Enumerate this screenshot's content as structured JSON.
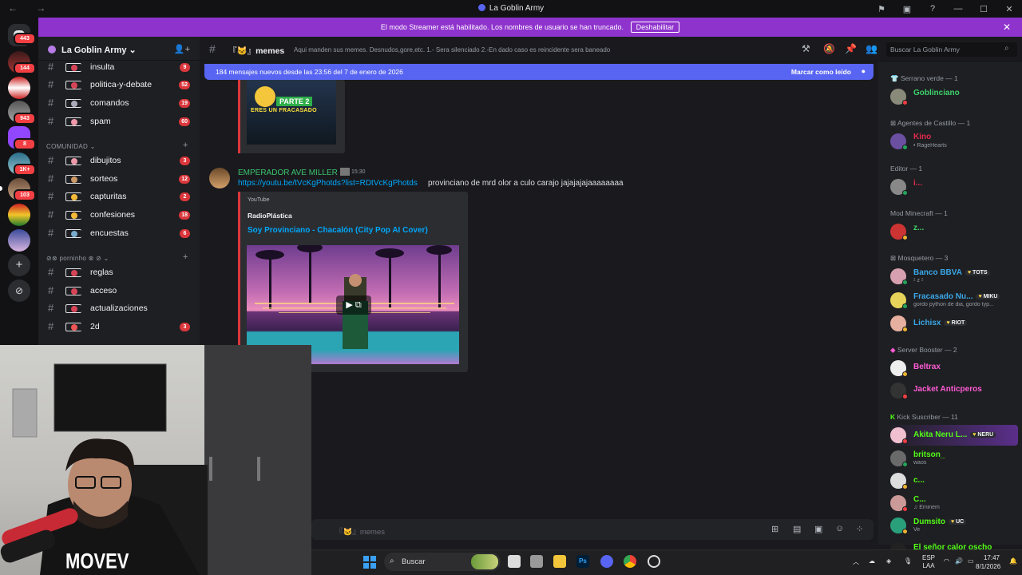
{
  "window": {
    "title": "La Goblin Army",
    "nav": "← →"
  },
  "banner": {
    "text": "El modo Streamer está habilitado. Los nombres de usuario se han truncado.",
    "button": "Deshabilitar"
  },
  "rail_badges": [
    "443",
    "144",
    "943",
    "8",
    "1K+",
    "103"
  ],
  "guild": {
    "name": "La Goblin Army"
  },
  "channels_top": [
    {
      "name": "insulta",
      "count": "9"
    },
    {
      "name": "politica-y-debate",
      "count": "52"
    },
    {
      "name": "comandos",
      "count": "19"
    },
    {
      "name": "spam",
      "count": "60"
    }
  ],
  "category_comunidad": "COMUNIDAD",
  "channels_comunidad": [
    {
      "name": "dibujitos",
      "count": "3"
    },
    {
      "name": "sorteos",
      "count": "12"
    },
    {
      "name": "capturitas",
      "count": "2"
    },
    {
      "name": "confesiones",
      "count": "18"
    },
    {
      "name": "encuestas",
      "count": "6"
    }
  ],
  "category_porn": "porninho",
  "channels_porn": [
    {
      "name": "reglas",
      "count": ""
    },
    {
      "name": "acceso",
      "count": ""
    },
    {
      "name": "actualizaciones",
      "count": ""
    },
    {
      "name": "2d",
      "count": "3"
    }
  ],
  "channel_header": {
    "name": "memes",
    "topic": "Aqui manden sus memes. Desnudos,gore,etc. 1.- Sera silenciado 2.-En dado caso es reincidente sera baneado"
  },
  "search": {
    "placeholder": "Buscar La Goblin Army"
  },
  "new_messages": {
    "text": "184 mensajes nuevos desde las 23:56 del 7 de enero de 2026",
    "action": "Marcar como leído"
  },
  "prev_embed": {
    "badge": "PARTE 2",
    "caption": "ERES UN FRACASADO"
  },
  "message": {
    "author": "EMPERADOR AVE MILLER",
    "time": "15:30",
    "link": "https://youtu.be/tVcKgPhotds?list=RDtVcKgPhotds",
    "text": "provinciano de mrd olor a culo carajo jajajajajaaaaaaaa",
    "embed": {
      "provider": "YouTube",
      "author": "RadioPlástica",
      "title": "Soy Provinciano - Chacalón (City Pop AI Cover)"
    }
  },
  "composer": {
    "placeholder": "memes"
  },
  "members": {
    "groups": [
      {
        "label": "Serrano verde — 1"
      },
      {
        "label": "Agentes de Castillo — 1"
      },
      {
        "label": "Editor — 1"
      },
      {
        "label": "Mod Minecraft — 1"
      },
      {
        "label": "Mosquetero — 3"
      },
      {
        "label": "Server Booster — 2"
      },
      {
        "label": "Kick Suscriber — 11"
      }
    ],
    "list": [
      {
        "name": "Goblinciano",
        "sub": "",
        "tag": "",
        "color": "#3ed16b"
      },
      {
        "name": "Kino",
        "sub": "• RageHearts",
        "tag": "",
        "color": "#e0294d"
      },
      {
        "name": "i...",
        "sub": "",
        "tag": "",
        "color": "#e0294d"
      },
      {
        "name": "z...",
        "sub": "",
        "tag": "",
        "color": "#3ed16b"
      },
      {
        "name": "Banco BBVA",
        "sub": "ᶻ z ᶻ",
        "tag": "TOTS",
        "color": "#3aa7e8"
      },
      {
        "name": "Fracasado Nu...",
        "sub": "gordo python de dia, gordo typ...",
        "tag": "MIKU",
        "color": "#3aa7e8"
      },
      {
        "name": "Lichisx",
        "sub": "",
        "tag": "RIOT",
        "color": "#3aa7e8"
      },
      {
        "name": "Beltrax",
        "sub": "",
        "tag": "",
        "color": "#ff5bd5"
      },
      {
        "name": "Jacket Anticperos",
        "sub": "",
        "tag": "",
        "color": "#ff5bd5"
      },
      {
        "name": "Akita Neru L...",
        "sub": "",
        "tag": "NERU",
        "color": "#53fc18"
      },
      {
        "name": "britson_",
        "sub": "waos",
        "tag": "",
        "color": "#53fc18"
      },
      {
        "name": "c...",
        "sub": "",
        "tag": "",
        "color": "#53fc18"
      },
      {
        "name": "C...",
        "sub": "♫ Eminem",
        "tag": "",
        "color": "#53fc18"
      },
      {
        "name": "Dumsito",
        "sub": "Ve",
        "tag": "UC",
        "color": "#53fc18"
      },
      {
        "name": "El señor calor oscho",
        "sub": "",
        "tag": "",
        "color": "#53fc18"
      }
    ]
  },
  "webcam": {
    "shirt_text": "MOVEV"
  },
  "taskbar": {
    "search": "Buscar",
    "lang": "ESP",
    "layout": "LAA",
    "time": "17:47",
    "date": "8/1/2026"
  }
}
